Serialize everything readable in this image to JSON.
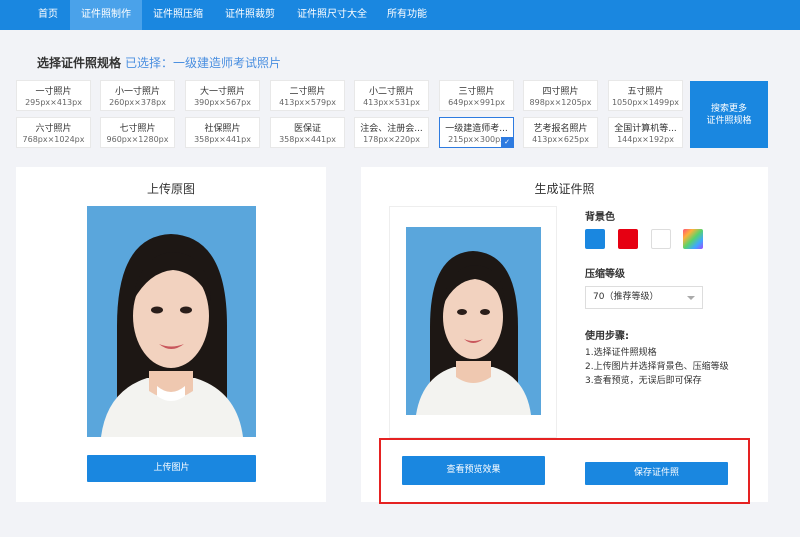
{
  "nav": {
    "items": [
      "首页",
      "证件照制作",
      "证件照压缩",
      "证件照裁剪",
      "证件照尺寸大全",
      "所有功能"
    ],
    "active_index": 1
  },
  "spec": {
    "title": "选择证件照规格",
    "selected": "已选择：一级建造师考试照片",
    "items": [
      {
        "name": "一寸照片",
        "size": "295px×413px"
      },
      {
        "name": "小一寸照片",
        "size": "260px×378px"
      },
      {
        "name": "大一寸照片",
        "size": "390px×567px"
      },
      {
        "name": "二寸照片",
        "size": "413px×579px"
      },
      {
        "name": "小二寸照片",
        "size": "413px×531px"
      },
      {
        "name": "三寸照片",
        "size": "649px×991px"
      },
      {
        "name": "四寸照片",
        "size": "898px×1205px"
      },
      {
        "name": "五寸照片",
        "size": "1050px×1499px"
      },
      {
        "name": "六寸照片",
        "size": "768px×1024px"
      },
      {
        "name": "七寸照片",
        "size": "960px×1280px"
      },
      {
        "name": "社保照片",
        "size": "358px×441px"
      },
      {
        "name": "医保证",
        "size": "358px×441px"
      },
      {
        "name": "注会、注册会...",
        "size": "178px×220px"
      },
      {
        "name": "一级建造师考...",
        "size": "215px×300px",
        "selected": true
      },
      {
        "name": "艺考报名照片",
        "size": "413px×625px"
      },
      {
        "name": "全国计算机等...",
        "size": "144px×192px"
      }
    ],
    "search_more": [
      "搜索更多",
      "证件照规格"
    ]
  },
  "upload_panel": {
    "title": "上传原图",
    "upload_button": "上传图片"
  },
  "result_panel": {
    "title": "生成证件照",
    "bg_label": "背景色",
    "bg_colors": [
      "#1a87e0",
      "#e60012",
      "#ffffff",
      "rainbow"
    ],
    "compress_label": "压缩等级",
    "compress_value": "70（推荐等级）",
    "steps_label": "使用步骤:",
    "steps": [
      "1.选择证件照规格",
      "2.上传图片并选择背景色、压缩等级",
      "3.查看预览，无误后即可保存"
    ],
    "preview_button": "查看预览效果",
    "save_button": "保存证件照"
  }
}
